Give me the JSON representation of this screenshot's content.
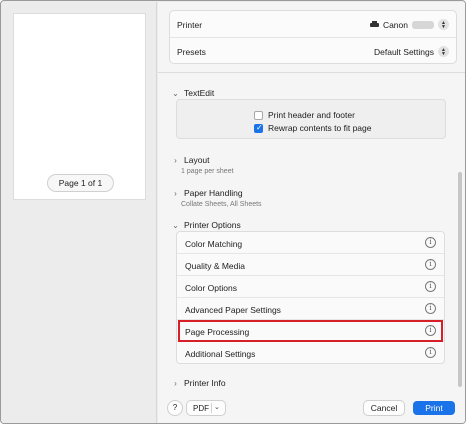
{
  "preview": {
    "page_indicator": "Page 1 of 1"
  },
  "printer": {
    "label": "Printer",
    "value": "Canon"
  },
  "presets": {
    "label": "Presets",
    "value": "Default Settings"
  },
  "textedit": {
    "title": "TextEdit",
    "options": [
      {
        "label": "Print header and footer",
        "checked": false
      },
      {
        "label": "Rewrap contents to fit page",
        "checked": true
      }
    ]
  },
  "layout": {
    "title": "Layout",
    "summary": "1 page per sheet"
  },
  "paper_handling": {
    "title": "Paper Handling",
    "summary": "Collate Sheets, All Sheets"
  },
  "printer_options": {
    "title": "Printer Options",
    "items": [
      "Color Matching",
      "Quality & Media",
      "Color Options",
      "Advanced Paper Settings",
      "Page Processing",
      "Additional Settings"
    ],
    "highlighted": "Page Processing",
    "highlight_color": "#d61f26"
  },
  "printer_info": {
    "title": "Printer Info"
  },
  "footer": {
    "help": "?",
    "pdf": "PDF",
    "cancel": "Cancel",
    "print": "Print"
  },
  "colors": {
    "accent": "#1a73e8"
  }
}
